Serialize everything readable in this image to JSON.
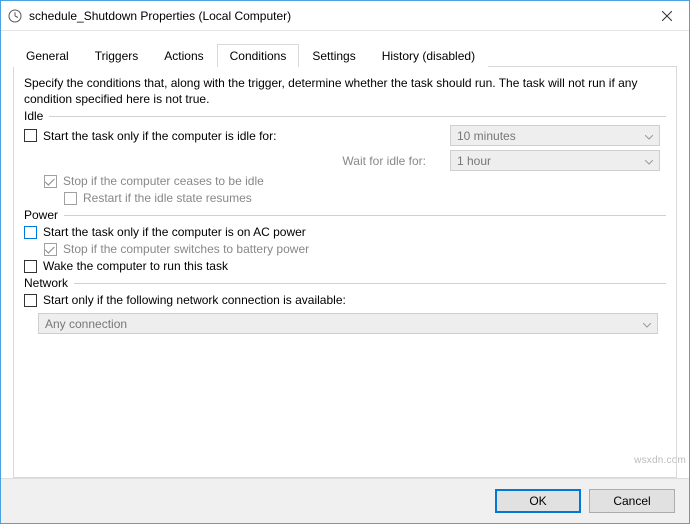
{
  "window": {
    "title": "schedule_Shutdown Properties (Local Computer)"
  },
  "tabs": {
    "general": "General",
    "triggers": "Triggers",
    "actions": "Actions",
    "conditions": "Conditions",
    "settings": "Settings",
    "history": "History (disabled)"
  },
  "description": "Specify the conditions that, along with the trigger, determine whether the task should run.  The task will not run  if any condition specified here is not true.",
  "idle": {
    "heading": "Idle",
    "start_only_if_idle": "Start the task only if the computer is idle for:",
    "idle_duration": "10 minutes",
    "wait_for_idle_label": "Wait for idle for:",
    "wait_for_idle_duration": "1 hour",
    "stop_if_ceases": "Stop if the computer ceases to be idle",
    "restart_if_resumes": "Restart if the idle state resumes"
  },
  "power": {
    "heading": "Power",
    "start_on_ac": "Start the task only if the computer is on AC power",
    "stop_on_battery": "Stop if the computer switches to battery power",
    "wake_to_run": "Wake the computer to run this task"
  },
  "network": {
    "heading": "Network",
    "start_if_conn": "Start only if the following network connection is available:",
    "connection": "Any connection"
  },
  "buttons": {
    "ok": "OK",
    "cancel": "Cancel"
  },
  "watermark": "wsxdn.com"
}
